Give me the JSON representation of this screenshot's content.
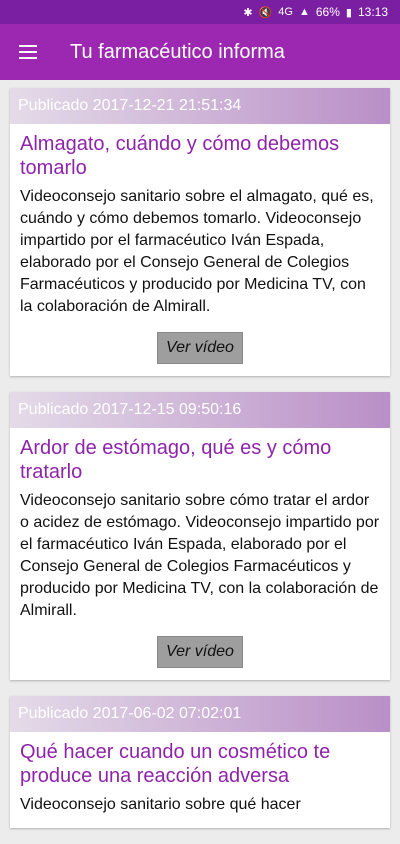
{
  "status_bar": {
    "battery": "66%",
    "time": "13:13",
    "network": "4G",
    "icons": [
      "bluetooth-icon",
      "mute-icon",
      "signal-icon",
      "battery-icon"
    ]
  },
  "app_bar": {
    "title": "Tu farmacéutico informa",
    "menu_icon": "hamburger-menu-icon"
  },
  "colors": {
    "primary": "#9c27b0",
    "primary_dark": "#7b1fa2",
    "title_text": "#8e24aa"
  },
  "posts": [
    {
      "published": "Publicado 2017-12-21 21:51:34",
      "title": "Almagato, cuándo y cómo debemos tomarlo",
      "description": "Videoconsejo sanitario sobre el almagato, qué es, cuándo y cómo debemos tomarlo. Videoconsejo impartido por el farmacéutico Iván Espada, elaborado por el Consejo General de Colegios Farmacéuticos y producido por Medicina TV, con la colaboración de Almirall.",
      "button_label": "Ver vídeo"
    },
    {
      "published": "Publicado 2017-12-15 09:50:16",
      "title": "Ardor de estómago, qué es y cómo tratarlo",
      "description": "Videoconsejo sanitario sobre cómo tratar el ardor o acidez de estómago. Videoconsejo impartido por el farmacéutico Iván Espada, elaborado por el Consejo General de Colegios Farmacéuticos y producido por Medicina TV, con la colaboración de Almirall.",
      "button_label": "Ver vídeo"
    },
    {
      "published": "Publicado 2017-06-02 07:02:01",
      "title": "Qué hacer cuando un cosmético te produce una reacción adversa",
      "description": "Videoconsejo sanitario sobre qué hacer",
      "button_label": ""
    }
  ]
}
